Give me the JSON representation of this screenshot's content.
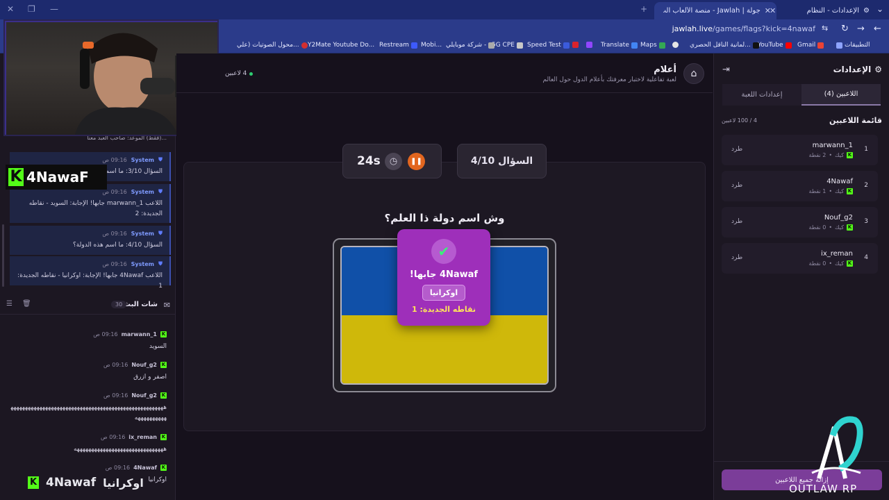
{
  "browser": {
    "tabs": [
      {
        "title": "الإعدادات - النظام"
      },
      {
        "title": "جولة | Jawlah - منصة الألعاب الت..."
      }
    ],
    "url_host": "jawlah.live",
    "url_path": "/games/flags?kick=4nawaf",
    "bookmarks": [
      "التطبيقات",
      "Gmail",
      "YouTube",
      "لمانية الناقل الحصري...",
      "Maps",
      "Translate",
      "Speed Test",
      "5G CPE",
      "شركة موبايلي -",
      "Mobi...",
      "Restream",
      "Y2Mate Youtube Do...",
      "محول الصوتيات (علي..."
    ]
  },
  "left": {
    "overlay_name": "4NawaF",
    "partial_line": "...(فقط) الموعد: صاحب العبد معنا",
    "system_messages": [
      {
        "who": "System",
        "time": "09:16 ص",
        "text": "السؤال 3/10: ما اسم هذه الدولة؟"
      },
      {
        "who": "System",
        "time": "09:16 ص",
        "text": "اللاعب marwann_1 جابها! الإجابة: السويد - نقاطه الجديدة: 2"
      },
      {
        "who": "System",
        "time": "09:16 ص",
        "text": "السؤال 4/10: ما اسم هذه الدولة؟"
      },
      {
        "who": "System",
        "time": "09:16 ص",
        "text": "اللاعب 4Nawaf جابها! الإجابة: اوكرانيا - نقاطه الجديدة: 1"
      }
    ],
    "chat_title": "شات البث",
    "chat_count": "30",
    "chat_messages": [
      {
        "who": "marwann_1",
        "time": "09:16 ص",
        "text": "السويد"
      },
      {
        "who": "Nouf_g2",
        "time": "09:16 ص",
        "text": "اصفر و ازرق"
      },
      {
        "who": "Nouf_g2",
        "time": "09:16 ص",
        "text": "ههههههههههههههههههههههههههههههههههههههههههههههههههههههههههههههههه"
      },
      {
        "who": "ix_reman",
        "time": "09:16 ص",
        "text": "هههههههههههههههههههههههههههههههه"
      },
      {
        "who": "4Nawaf",
        "time": "09:16 ص",
        "text": "اوكرانيا"
      }
    ],
    "caption_name": "4Nawaf",
    "caption_answer": "اوكرانيا"
  },
  "game": {
    "title": "أعلام",
    "subtitle": "لعبة تفاعلية لاختبار معرفتك بأعلام الدول حول العالم",
    "players_online": "4 لاعبين",
    "question_counter": "السؤال 4/10",
    "timer": "24s",
    "question": "وش اسم دولة ذا العلم؟",
    "popup_winner": "4Nawaf جابها!",
    "popup_answer": "اوكرانيا",
    "popup_points": "نقاطه الجديدة: 1",
    "flag_colors": [
      "#1050a8",
      "#cfb80a"
    ]
  },
  "right": {
    "title": "الإعدادات",
    "tab_players": "اللاعبين (4)",
    "tab_settings": "إعدادات اللعبة",
    "list_title": "قائمة اللاعبين",
    "list_count": "4 / 100 لاعبين",
    "players": [
      {
        "rank": "1",
        "name": "marwann_1",
        "points": "2 نقطة",
        "platform": "كيك",
        "kick": "طرد"
      },
      {
        "rank": "2",
        "name": "4Nawaf",
        "points": "1 نقطة",
        "platform": "كيك",
        "kick": "طرد"
      },
      {
        "rank": "3",
        "name": "Nouf_g2",
        "points": "0 نقطة",
        "platform": "كيك",
        "kick": "طرد"
      },
      {
        "rank": "4",
        "name": "ix_reman",
        "points": "0 نقطة",
        "platform": "كيك",
        "kick": "طرد"
      }
    ],
    "kick_all": "إزالة جميع اللاعبين",
    "watermark": "OUTLAW RP"
  }
}
